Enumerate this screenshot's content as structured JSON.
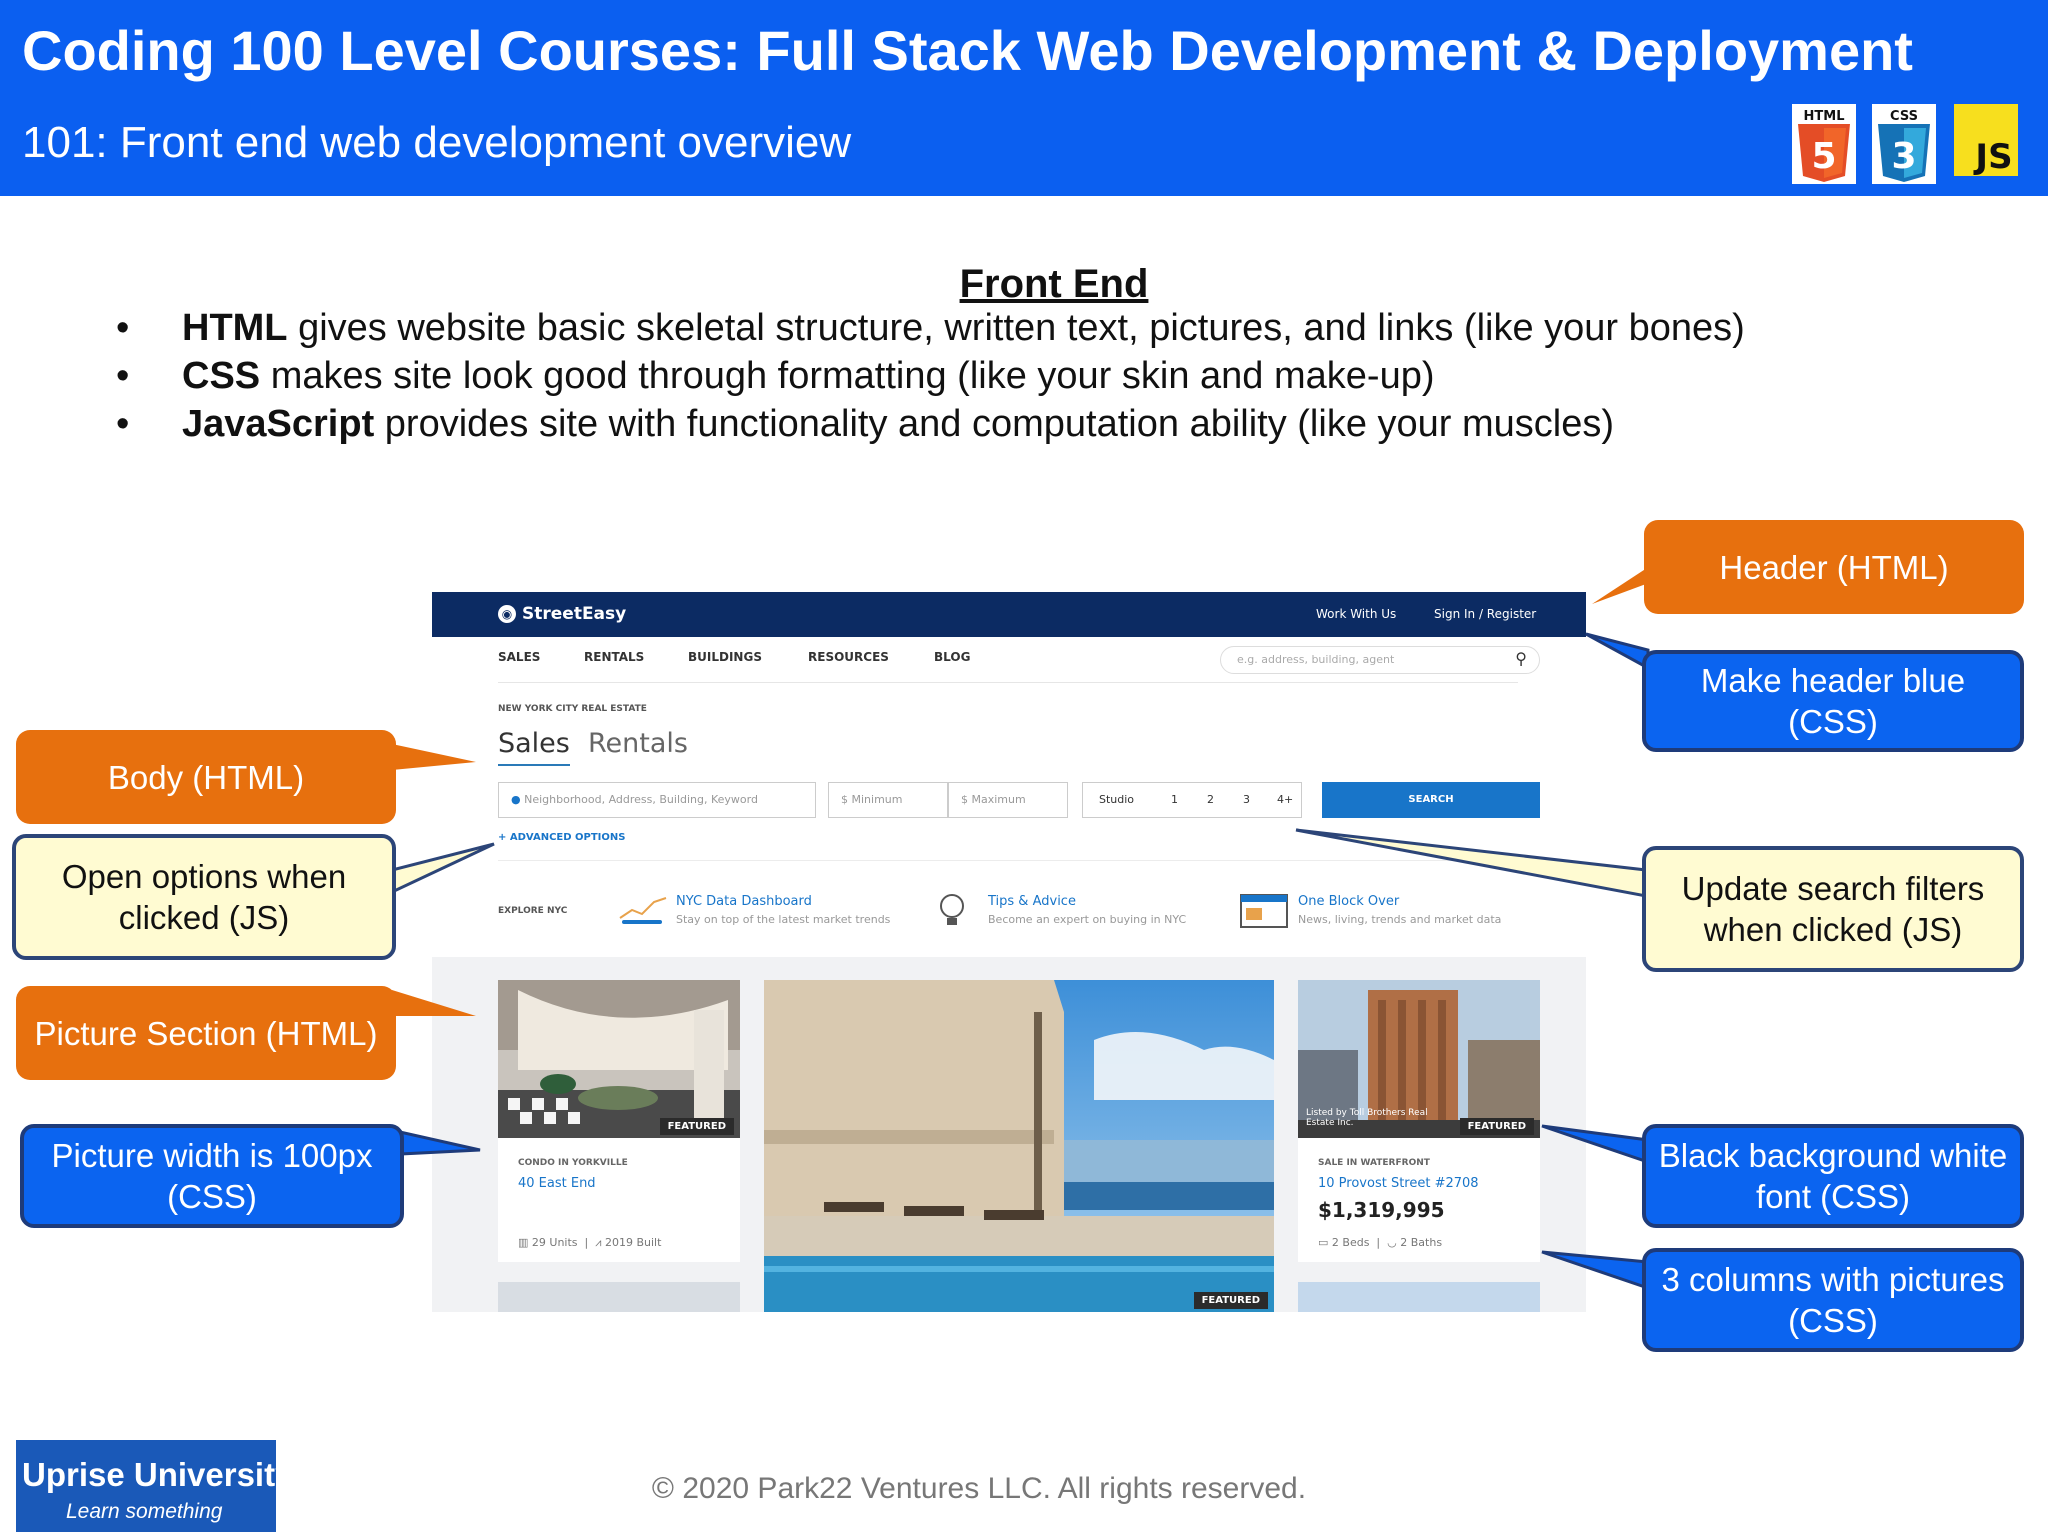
{
  "header": {
    "title": "Coding 100 Level Courses: Full Stack Web Development & Deployment",
    "subtitle": "101: Front end web development overview",
    "icons": [
      {
        "name": "html5-icon",
        "label": "HTML",
        "number": "5",
        "color": "#e44d26"
      },
      {
        "name": "css3-icon",
        "label": "CSS",
        "number": "3",
        "color": "#1572b6"
      },
      {
        "name": "js-icon",
        "label": "JS",
        "color": "#f7df1e"
      }
    ],
    "background": "#0b5ff0"
  },
  "front_end": {
    "heading": "Front End",
    "bullet_symbol": "•",
    "bullets": [
      {
        "term": "HTML",
        "text": " gives website basic skeletal structure, written text, pictures, and links (like your bones)"
      },
      {
        "term": "CSS",
        "text": " makes site look good through formatting (like your skin and make-up)"
      },
      {
        "term": "JavaScript",
        "text": " provides site with functionality and computation ability (like your muscles)"
      }
    ]
  },
  "callouts": {
    "header_html": "Header (HTML)",
    "make_header_blue": "Make header blue (CSS)",
    "body_html": "Body (HTML)",
    "open_options": "Open options when clicked (JS)",
    "update_filters": "Update search filters when clicked (JS)",
    "picture_section": "Picture Section (HTML)",
    "picture_width": "Picture width is 100px (CSS)",
    "black_background": "Black background white font (CSS)",
    "three_columns": "3 columns with pictures (CSS)",
    "colors": {
      "orange": "#e7700e",
      "blue": "#0b64f0",
      "yellow": "#fffbd2"
    }
  },
  "screenshot": {
    "brand": "StreetEasy",
    "top_links": [
      "Work With Us",
      "Sign In / Register"
    ],
    "nav": [
      "SALES",
      "RENTALS",
      "BUILDINGS",
      "RESOURCES",
      "BLOG"
    ],
    "search_placeholder": "e.g. address, building, agent",
    "kicker": "NEW YORK CITY REAL ESTATE",
    "tabs": [
      "Sales",
      "Rentals"
    ],
    "location_placeholder": "Neighborhood, Address, Building, Keyword",
    "min_placeholder": "$ Minimum",
    "max_placeholder": "$ Maximum",
    "beds": [
      "Studio",
      "1",
      "2",
      "3",
      "4+"
    ],
    "search_button": "SEARCH",
    "advanced": "+ ADVANCED OPTIONS",
    "explore": "EXPLORE NYC",
    "promos": [
      {
        "title": "NYC Data Dashboard",
        "sub": "Stay on top of the latest market trends"
      },
      {
        "title": "Tips & Advice",
        "sub": "Become an expert on buying in NYC"
      },
      {
        "title": "One Block Over",
        "sub": "News, living, trends and market data"
      }
    ],
    "featured": "FEATURED",
    "card_left": {
      "kicker": "CONDO IN YORKVILLE",
      "address": "40 East End",
      "units": "29 Units",
      "built": "2019 Built"
    },
    "card_right": {
      "kicker": "SALE IN WATERFRONT",
      "address": "10 Provost Street #2708",
      "price": "$1,319,995",
      "beds": "2 Beds",
      "baths": "2 Baths",
      "credit": "Listed by Toll Brothers Real Estate Inc."
    },
    "nav_color": "#0c2b63",
    "accent": "#1875c9"
  },
  "footer": {
    "logo_name": "Uprise University",
    "logo_tagline": "Learn something",
    "copyright": "© 2020 Park22 Ventures LLC. All rights reserved."
  }
}
